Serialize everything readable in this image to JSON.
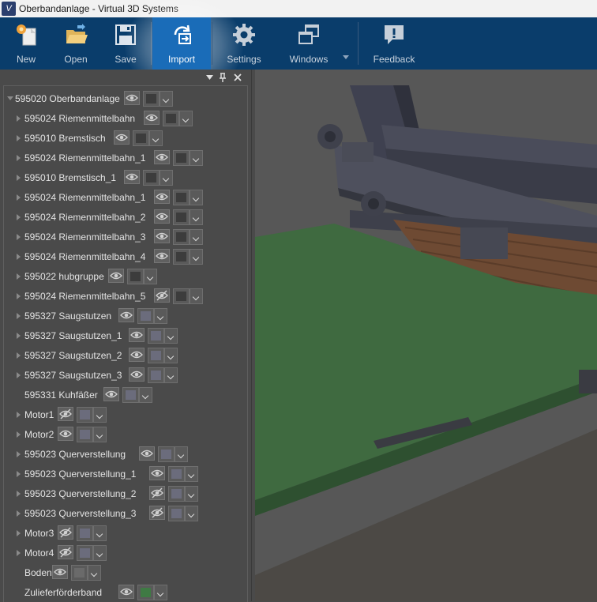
{
  "window": {
    "title": "Oberbandanlage - Virtual 3D Systems",
    "logo_text": "V"
  },
  "toolbar": {
    "buttons": [
      {
        "label": "New",
        "icon": "new-document-icon"
      },
      {
        "label": "Open",
        "icon": "open-folder-icon"
      },
      {
        "label": "Save",
        "icon": "save-disk-icon"
      },
      {
        "label": "Import",
        "icon": "import-arrows-icon",
        "active": true
      },
      {
        "label": "Settings",
        "icon": "gear-icon"
      },
      {
        "label": "Windows",
        "icon": "windows-cascade-icon"
      },
      {
        "label": "Feedback",
        "icon": "feedback-bubble-icon"
      }
    ]
  },
  "panel": {
    "header_icons": [
      "dropdown-arrow-icon",
      "pin-icon",
      "close-icon"
    ],
    "tree": [
      {
        "label": "595020 Oberbandanlage",
        "expander": "open",
        "visible": true,
        "color": "#3c3c3c"
      },
      {
        "label": "595024 Riemenmittelbahn",
        "expander": "closed",
        "visible": true,
        "color": "#3c3c3c"
      },
      {
        "label": "595010 Bremstisch",
        "expander": "closed",
        "visible": true,
        "color": "#3c3c3c"
      },
      {
        "label": "595024 Riemenmittelbahn_1",
        "expander": "closed",
        "visible": true,
        "color": "#3c3c3c"
      },
      {
        "label": "595010 Bremstisch_1",
        "expander": "closed",
        "visible": true,
        "color": "#3c3c3c"
      },
      {
        "label": "595024 Riemenmittelbahn_1",
        "expander": "closed",
        "visible": true,
        "color": "#3c3c3c"
      },
      {
        "label": "595024 Riemenmittelbahn_2",
        "expander": "closed",
        "visible": true,
        "color": "#3c3c3c"
      },
      {
        "label": "595024 Riemenmittelbahn_3",
        "expander": "closed",
        "visible": true,
        "color": "#3c3c3c"
      },
      {
        "label": "595024 Riemenmittelbahn_4",
        "expander": "closed",
        "visible": true,
        "color": "#3c3c3c"
      },
      {
        "label": "595022 hubgruppe",
        "expander": "closed",
        "visible": true,
        "color": "#3c3c3c"
      },
      {
        "label": "595024 Riemenmittelbahn_5",
        "expander": "closed",
        "visible": false,
        "color": "#3c3c3c"
      },
      {
        "label": "595327 Saugstutzen",
        "expander": "closed",
        "visible": true,
        "color": "#6b6c7c"
      },
      {
        "label": "595327 Saugstutzen_1",
        "expander": "closed",
        "visible": true,
        "color": "#6b6c7c"
      },
      {
        "label": "595327 Saugstutzen_2",
        "expander": "closed",
        "visible": true,
        "color": "#6b6c7c"
      },
      {
        "label": "595327 Saugstutzen_3",
        "expander": "closed",
        "visible": true,
        "color": "#6b6c7c"
      },
      {
        "label": "595331 Kuhfäßer",
        "expander": "none",
        "visible": true,
        "color": "#6b6c7c"
      },
      {
        "label": "Motor1",
        "expander": "closed",
        "visible": false,
        "color": "#6b6c7c"
      },
      {
        "label": "Motor2",
        "expander": "closed",
        "visible": true,
        "color": "#6b6c7c"
      },
      {
        "label": "595023 Querverstellung",
        "expander": "closed",
        "visible": true,
        "color": "#6b6c7c"
      },
      {
        "label": "595023 Querverstellung_1",
        "expander": "closed",
        "visible": true,
        "color": "#6b6c7c"
      },
      {
        "label": "595023 Querverstellung_2",
        "expander": "closed",
        "visible": false,
        "color": "#6b6c7c"
      },
      {
        "label": "595023 Querverstellung_3",
        "expander": "closed",
        "visible": false,
        "color": "#6b6c7c"
      },
      {
        "label": "Motor3",
        "expander": "closed",
        "visible": false,
        "color": "#6b6c7c"
      },
      {
        "label": "Motor4",
        "expander": "closed",
        "visible": false,
        "color": "#6b6c7c"
      },
      {
        "label": "Boden",
        "expander": "none",
        "visible": true,
        "color": "#6a6a6a"
      },
      {
        "label": "Zulieferförderband",
        "expander": "none",
        "visible": true,
        "color": "#3f7a44"
      }
    ]
  }
}
